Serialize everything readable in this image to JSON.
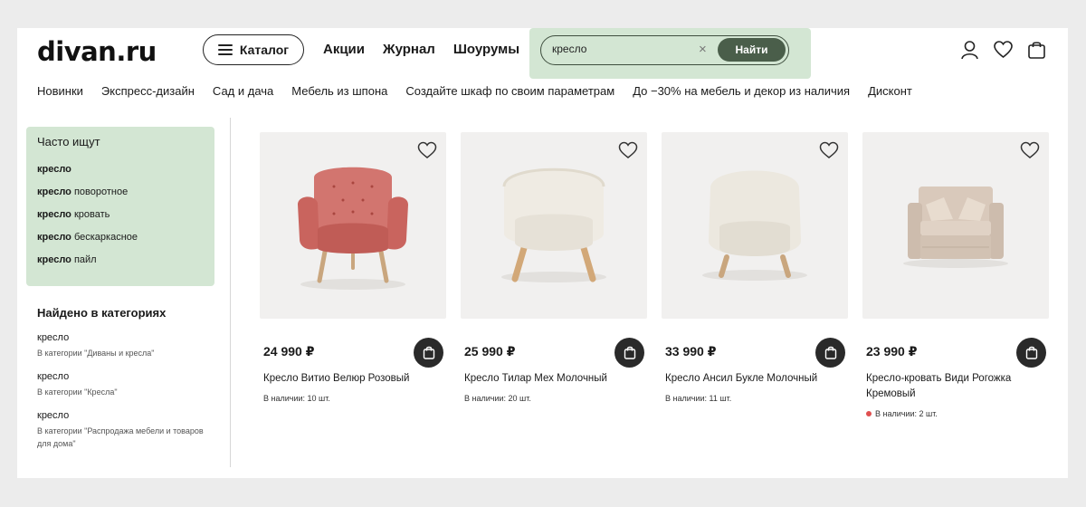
{
  "header": {
    "logo": "divan.ru",
    "catalog_label": "Каталог",
    "links": [
      "Акции",
      "Журнал",
      "Шоурумы"
    ],
    "search": {
      "value": "кресло",
      "button_label": "Найти",
      "clear_glyph": "×"
    },
    "icons": [
      "user-icon",
      "heart-icon",
      "bag-icon"
    ]
  },
  "nav": [
    "Новинки",
    "Экспресс-дизайн",
    "Сад и дача",
    "Мебель из шпона",
    "Создайте шкаф по своим параметрам",
    "До −30% на мебель и декор из наличия",
    "Дисконт"
  ],
  "sidebar": {
    "often_title": "Часто ищут",
    "often_items": [
      {
        "bold": "кресло",
        "rest": ""
      },
      {
        "bold": "кресло",
        "rest": " поворотное"
      },
      {
        "bold": "кресло",
        "rest": " кровать"
      },
      {
        "bold": "кресло",
        "rest": " бескаркасное"
      },
      {
        "bold": "кресло",
        "rest": " пайл"
      }
    ],
    "found_title": "Найдено в категориях",
    "found_items": [
      {
        "q": "кресло",
        "cat": "В категории \"Диваны и кресла\""
      },
      {
        "q": "кресло",
        "cat": "В категории \"Кресла\""
      },
      {
        "q": "кресло",
        "cat": "В категории \"Распродажа мебели и товаров для дома\""
      }
    ]
  },
  "products": [
    {
      "price": "24 990 ₽",
      "title": "Кресло Витио Велюр Розовый",
      "stock": "В наличии: 10 шт.",
      "low_stock": false,
      "color": "#d2756f"
    },
    {
      "price": "25 990 ₽",
      "title": "Кресло Тилар Мех Молочный",
      "stock": "В наличии: 20 шт.",
      "low_stock": false,
      "color": "#efebe3"
    },
    {
      "price": "33 990 ₽",
      "title": "Кресло Ансил Букле Молочный",
      "stock": "В наличии: 11 шт.",
      "low_stock": false,
      "color": "#ece8df"
    },
    {
      "price": "23 990 ₽",
      "title": "Кресло-кровать Види Рогожка Кремовый",
      "stock": "В наличии: 2 шт.",
      "low_stock": true,
      "color": "#d9c9bb"
    }
  ],
  "colors": {
    "accent_green": "#d3e6d3",
    "button_dark": "#4a5e4a",
    "low_stock_dot": "#e05050"
  }
}
